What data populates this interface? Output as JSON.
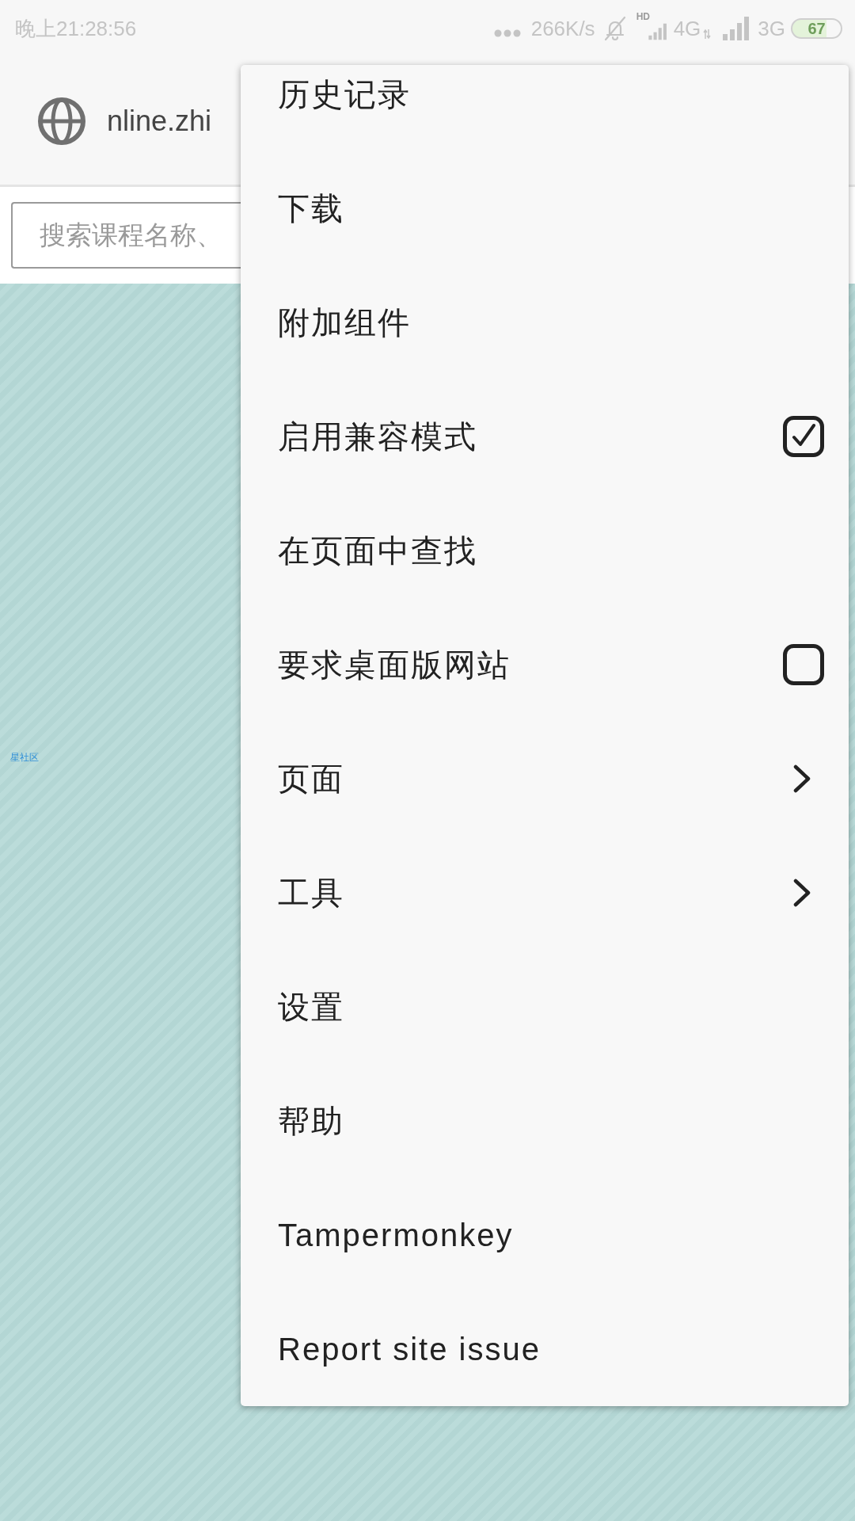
{
  "status_bar": {
    "time": "晚上21:28:56",
    "speed": "266K/s",
    "hd_label": "HD",
    "network_primary": "4G",
    "network_secondary": "3G",
    "battery": "67"
  },
  "address_bar": {
    "url": "nline.zhi"
  },
  "search": {
    "placeholder": "搜索课程名称、"
  },
  "page": {
    "link_text": "星社区"
  },
  "menu": {
    "items": [
      {
        "label": "历史记录",
        "kind": "plain"
      },
      {
        "label": "下载",
        "kind": "plain"
      },
      {
        "label": "附加组件",
        "kind": "plain"
      },
      {
        "label": "启用兼容模式",
        "kind": "checkbox",
        "checked": true
      },
      {
        "label": "在页面中查找",
        "kind": "plain"
      },
      {
        "label": "要求桌面版网站",
        "kind": "checkbox",
        "checked": false
      },
      {
        "label": "页面",
        "kind": "submenu"
      },
      {
        "label": "工具",
        "kind": "submenu"
      },
      {
        "label": "设置",
        "kind": "plain"
      },
      {
        "label": "帮助",
        "kind": "plain"
      },
      {
        "label": "Tampermonkey",
        "kind": "plain"
      },
      {
        "label": "Report site issue",
        "kind": "plain"
      }
    ]
  }
}
